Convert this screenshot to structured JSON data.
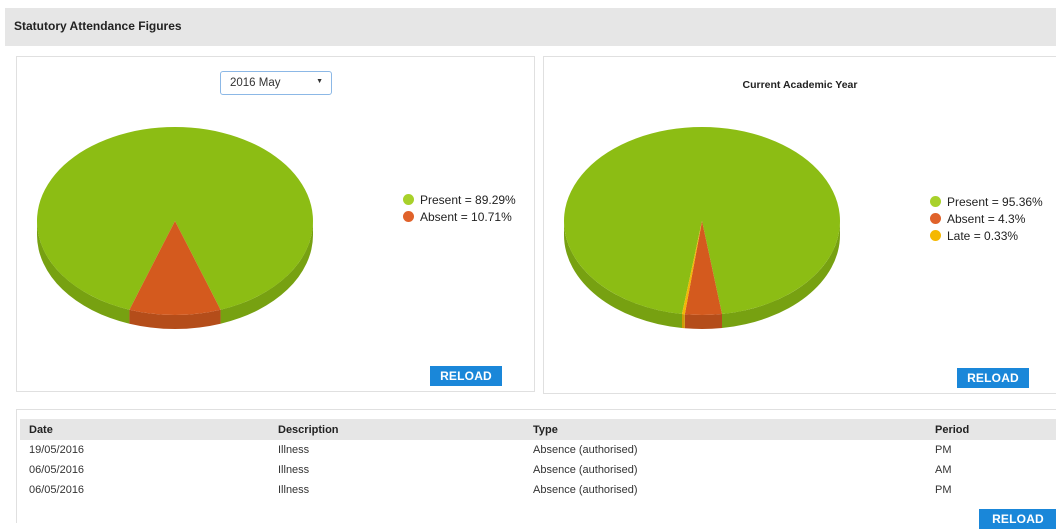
{
  "panel": {
    "title": "Statutory Attendance Figures"
  },
  "month_chart": {
    "selected_month": "2016 May",
    "reload_label": "RELOAD",
    "chart_data": {
      "type": "pie",
      "title": "",
      "slices": [
        {
          "label": "Present",
          "value": 89.29,
          "color": "#8cbd14",
          "legend": "Present = 89.29%"
        },
        {
          "label": "Absent",
          "value": 10.71,
          "color": "#d45a1e",
          "legend": "Absent = 10.71%"
        }
      ],
      "legend_position": "right"
    }
  },
  "year_chart": {
    "title": "Current Academic Year",
    "reload_label": "RELOAD",
    "chart_data": {
      "type": "pie",
      "title": "Current Academic Year",
      "slices": [
        {
          "label": "Present",
          "value": 95.36,
          "color": "#8cbd14",
          "legend": "Present = 95.36%"
        },
        {
          "label": "Absent",
          "value": 4.3,
          "color": "#d45a1e",
          "legend": "Absent = 4.3%"
        },
        {
          "label": "Late",
          "value": 0.33,
          "color": "#f2b705",
          "legend": "Late = 0.33%"
        }
      ],
      "legend_position": "right"
    }
  },
  "table": {
    "headers": {
      "date": "Date",
      "description": "Description",
      "type": "Type",
      "period": "Period"
    },
    "rows": [
      {
        "date": "19/05/2016",
        "description": "Illness",
        "type": "Absence (authorised)",
        "period": "PM"
      },
      {
        "date": "06/05/2016",
        "description": "Illness",
        "type": "Absence (authorised)",
        "period": "AM"
      },
      {
        "date": "06/05/2016",
        "description": "Illness",
        "type": "Absence (authorised)",
        "period": "PM"
      }
    ],
    "reload_label": "RELOAD"
  }
}
